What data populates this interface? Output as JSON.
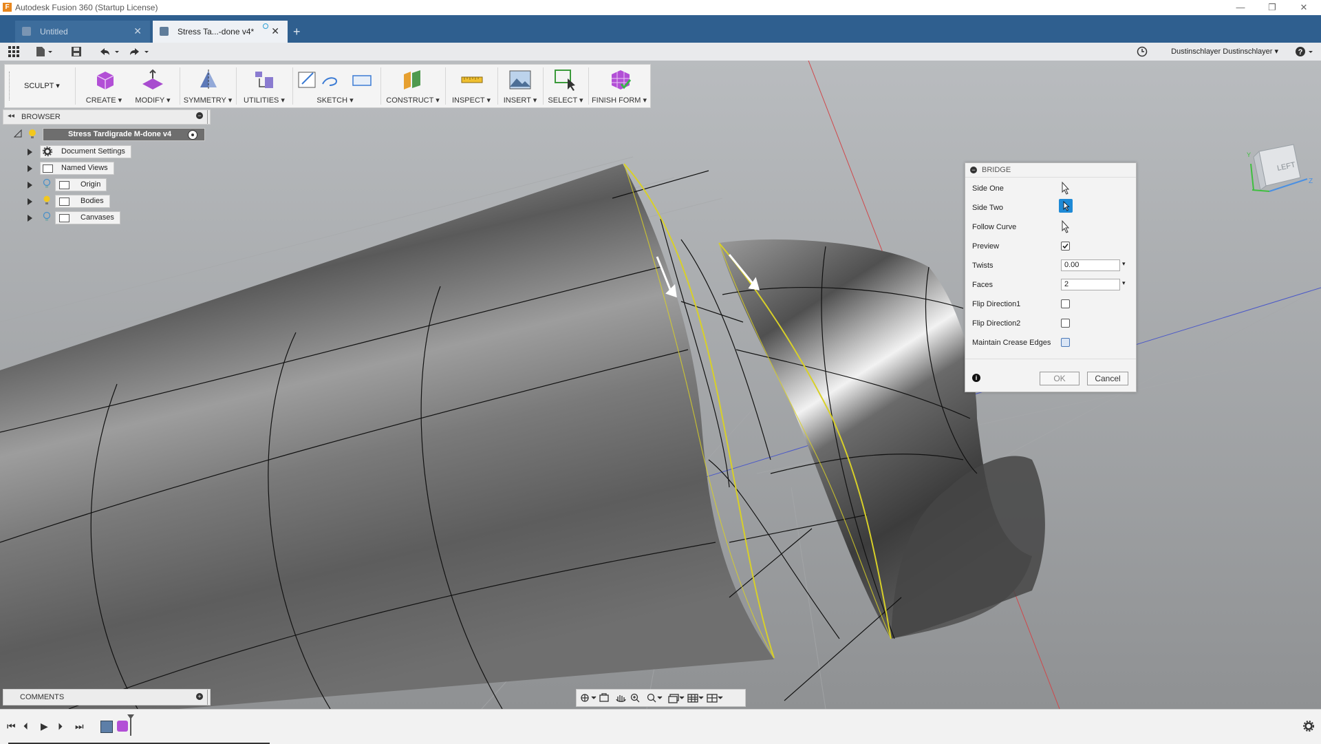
{
  "window": {
    "title": "Autodesk Fusion 360 (Startup License)",
    "controls": [
      "minimize-icon",
      "restore-icon",
      "close-icon"
    ]
  },
  "tabs": [
    {
      "label": "Untitled",
      "active": false
    },
    {
      "label": "Stress Ta...-done v4*",
      "active": true
    }
  ],
  "quick_access": {
    "user": "Dustinschlayer Dustinschlayer ▾"
  },
  "ribbon": {
    "workspace": "SCULPT",
    "groups": [
      {
        "label": "CREATE ▾"
      },
      {
        "label": "MODIFY ▾"
      },
      {
        "label": "SYMMETRY ▾"
      },
      {
        "label": "UTILITIES ▾"
      },
      {
        "label": "SKETCH ▾"
      },
      {
        "label": "CONSTRUCT ▾"
      },
      {
        "label": "INSPECT ▾"
      },
      {
        "label": "INSERT ▾"
      },
      {
        "label": "SELECT ▾"
      },
      {
        "label": "FINISH FORM ▾"
      }
    ]
  },
  "browser": {
    "title": "BROWSER",
    "root": "Stress Tardigrade M-done v4",
    "items": [
      {
        "label": "Document Settings"
      },
      {
        "label": "Named Views"
      },
      {
        "label": "Origin"
      },
      {
        "label": "Bodies"
      },
      {
        "label": "Canvases"
      }
    ]
  },
  "viewcube": {
    "face": "LEFT",
    "axis_y": "Y",
    "axis_z": "Z"
  },
  "bridge": {
    "title": "BRIDGE",
    "side_one": "Side One",
    "side_two": "Side Two",
    "follow_curve": "Follow Curve",
    "preview": "Preview",
    "twists_label": "Twists",
    "twists_value": "0.00",
    "faces_label": "Faces",
    "faces_value": "2",
    "flip1": "Flip Direction1",
    "flip2": "Flip Direction2",
    "crease": "Maintain Crease Edges",
    "ok": "OK",
    "cancel": "Cancel"
  },
  "comments": {
    "title": "COMMENTS"
  },
  "colors": {
    "tab_strip": "#2f5f8f",
    "accent": "#1e8ad6",
    "selection_edge": "#d8d028"
  }
}
